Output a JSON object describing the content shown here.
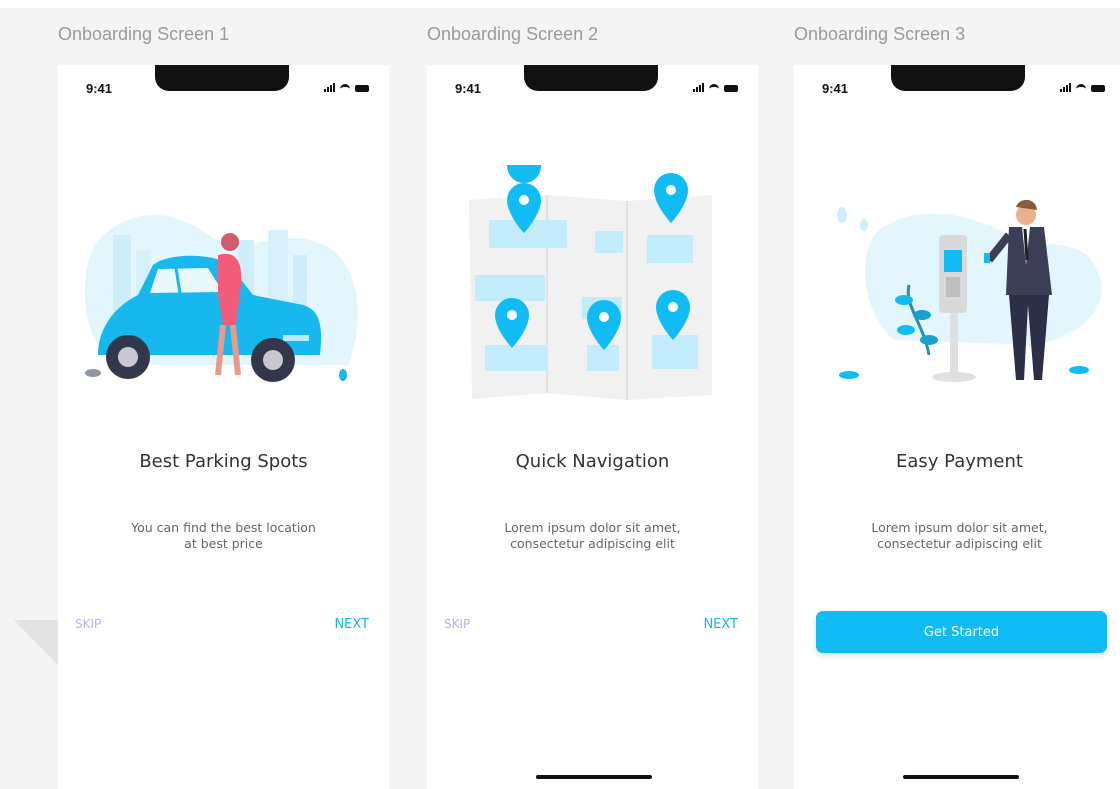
{
  "status_time": "9:41",
  "colors": {
    "accent": "#11bcf5",
    "skip": "#b8b0ee",
    "next": "#12b6f0"
  },
  "screens": [
    {
      "label": "Onboarding Screen 1",
      "title": "Best Parking Spots",
      "desc": [
        "You can find the best location",
        "at best price"
      ],
      "skip": "SKIP",
      "next": "NEXT",
      "illustration": "car-woman-city-illustration"
    },
    {
      "label": "Onboarding Screen 2",
      "title": "Quick Navigation",
      "desc": [
        "Lorem ipsum dolor sit amet,",
        "consectetur adipiscing elit"
      ],
      "skip": "SKIP",
      "next": "NEXT",
      "illustration": "map-pins-illustration"
    },
    {
      "label": "Onboarding Screen 3",
      "title": "Easy Payment",
      "desc": [
        "Lorem ipsum dolor sit amet,",
        "consectetur adipiscing elit"
      ],
      "cta": "Get Started",
      "illustration": "man-payment-terminal-illustration"
    }
  ]
}
